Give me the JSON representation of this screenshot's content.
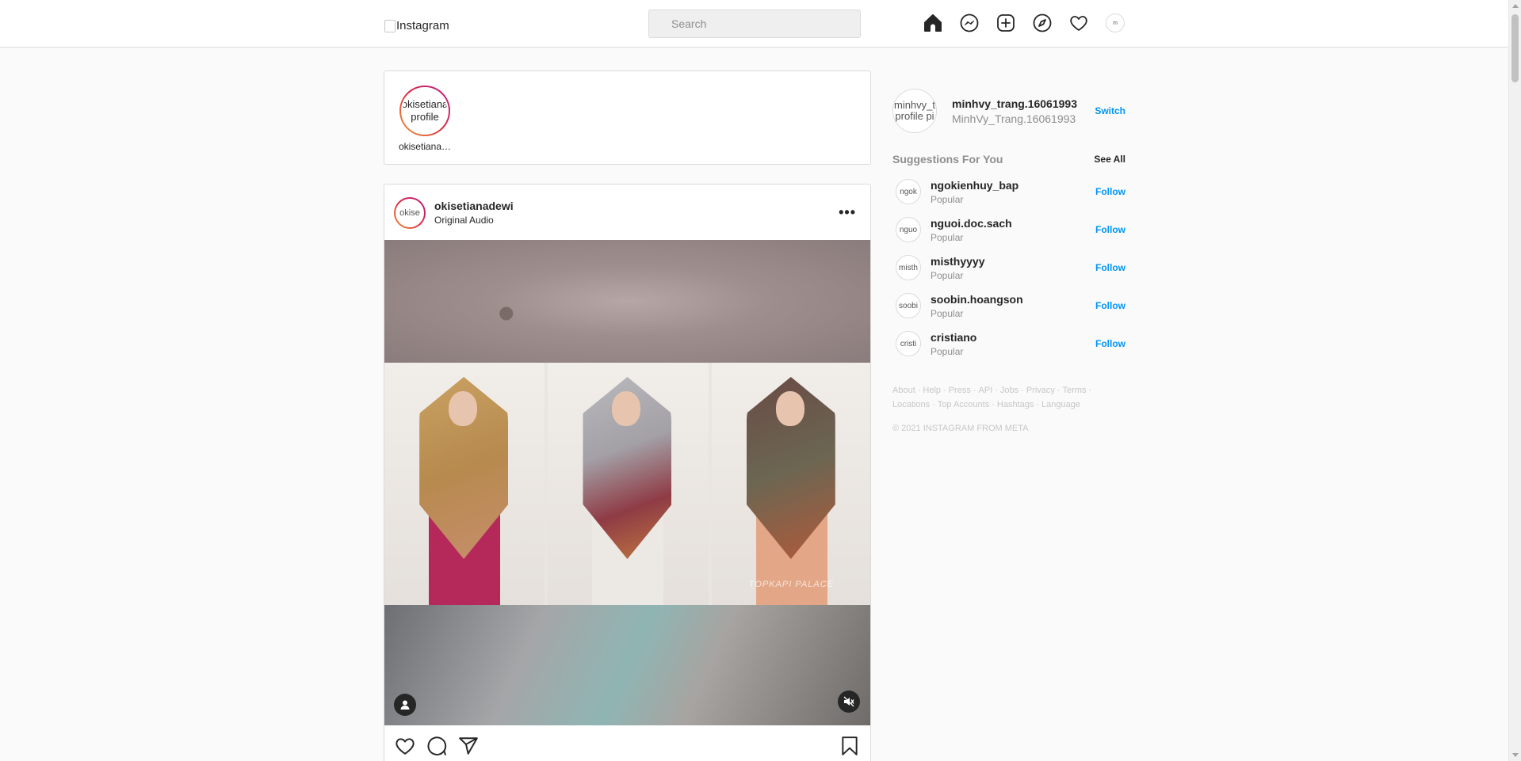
{
  "nav": {
    "logo_alt": "Instagram",
    "search_placeholder": "Search",
    "icons": [
      "home-icon",
      "messenger-icon",
      "new-post-icon",
      "explore-icon",
      "activity-heart-icon",
      "profile-avatar"
    ],
    "profile_alt": "m"
  },
  "stories": [
    {
      "username": "okisetiana…",
      "avatar_alt": "okisetiana profile"
    }
  ],
  "post": {
    "username": "okisetianadewi",
    "subtitle": "Original Audio",
    "avatar_alt": "okise",
    "more_label": "•••",
    "watermark": "TOPKAPI PALACE",
    "actions": [
      "like-icon",
      "comment-icon",
      "share-icon",
      "save-icon"
    ]
  },
  "sidebar": {
    "me": {
      "avatar_alt": "minhvy_t profile pi",
      "username": "minhvy_trang.16061993",
      "name": "MinhVy_Trang.16061993",
      "switch_label": "Switch"
    },
    "suggestions_title": "Suggestions For You",
    "see_all_label": "See All",
    "suggestions": [
      {
        "username": "ngokienhuy_bap",
        "sub": "Popular",
        "avatar_alt": "ngok",
        "follow": "Follow"
      },
      {
        "username": "nguoi.doc.sach",
        "sub": "Popular",
        "avatar_alt": "nguo",
        "follow": "Follow"
      },
      {
        "username": "misthyyyy",
        "sub": "Popular",
        "avatar_alt": "misth",
        "follow": "Follow"
      },
      {
        "username": "soobin.hoangson",
        "sub": "Popular",
        "avatar_alt": "soobi",
        "follow": "Follow"
      },
      {
        "username": "cristiano",
        "sub": "Popular",
        "avatar_alt": "cristi",
        "follow": "Follow"
      }
    ],
    "footer_links_row1": [
      "About",
      "Help",
      "Press",
      "API",
      "Jobs",
      "Privacy",
      "Terms"
    ],
    "footer_links_row2": [
      "Locations",
      "Top Accounts",
      "Hashtags",
      "Language"
    ],
    "copyright": "© 2021 INSTAGRAM FROM META"
  },
  "colors": {
    "accent_blue": "#0095f6",
    "border": "#dbdbdb",
    "background": "#fafafa",
    "muted_text": "#8e8e8e"
  }
}
